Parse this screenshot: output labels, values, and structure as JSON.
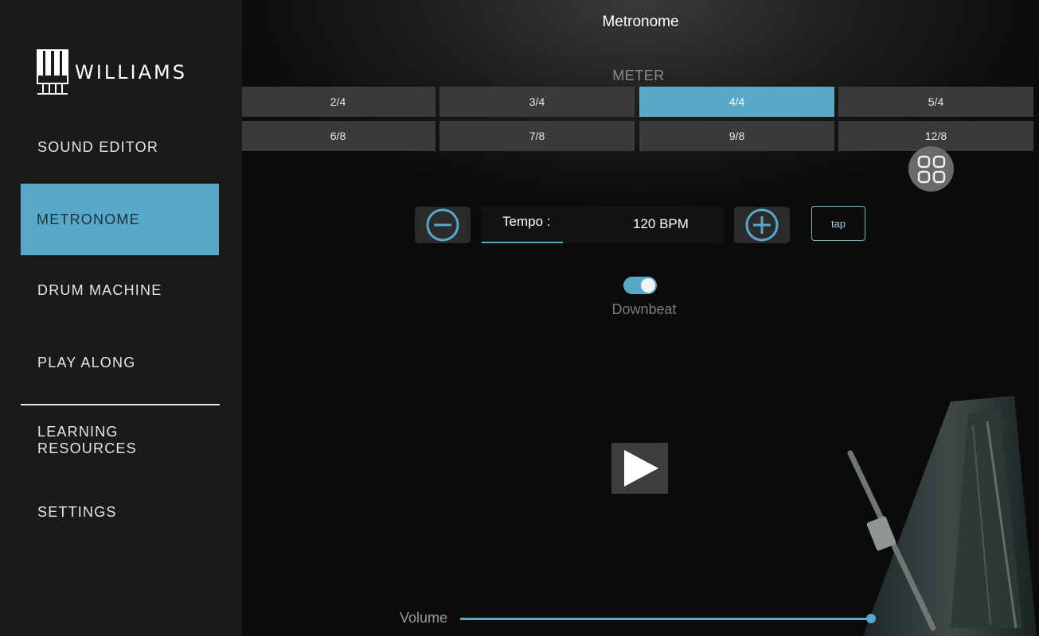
{
  "sidebar": {
    "brand": "WILLIAMS",
    "items": [
      {
        "label": "SOUND EDITOR",
        "active": false
      },
      {
        "label": "METRONOME",
        "active": true
      },
      {
        "label": "DRUM MACHINE",
        "active": false
      },
      {
        "label": "PLAY ALONG",
        "active": false
      },
      {
        "label": "LEARNING\nRESOURCES",
        "active": false
      },
      {
        "label": "SETTINGS",
        "active": false
      }
    ]
  },
  "main": {
    "title": "Metronome",
    "meter_label": "METER",
    "meters": [
      "2/4",
      "3/4",
      "4/4",
      "5/4",
      "6/8",
      "7/8",
      "9/8",
      "12/8"
    ],
    "selected_meter": "4/4",
    "tempo": {
      "label": "Tempo :",
      "value": "120 BPM",
      "minus_icon": "minus-circle-icon",
      "plus_icon": "plus-circle-icon"
    },
    "tap_label": "tap",
    "downbeat": {
      "label": "Downbeat",
      "on": true
    },
    "play_icon": "play-icon",
    "grid_icon": "grid-icon",
    "volume": {
      "label": "Volume",
      "level": 1.0
    }
  },
  "colors": {
    "accent": "#58a9c9",
    "sidebar_bg": "#1a1a1a",
    "button_bg": "#3a3a3a"
  }
}
